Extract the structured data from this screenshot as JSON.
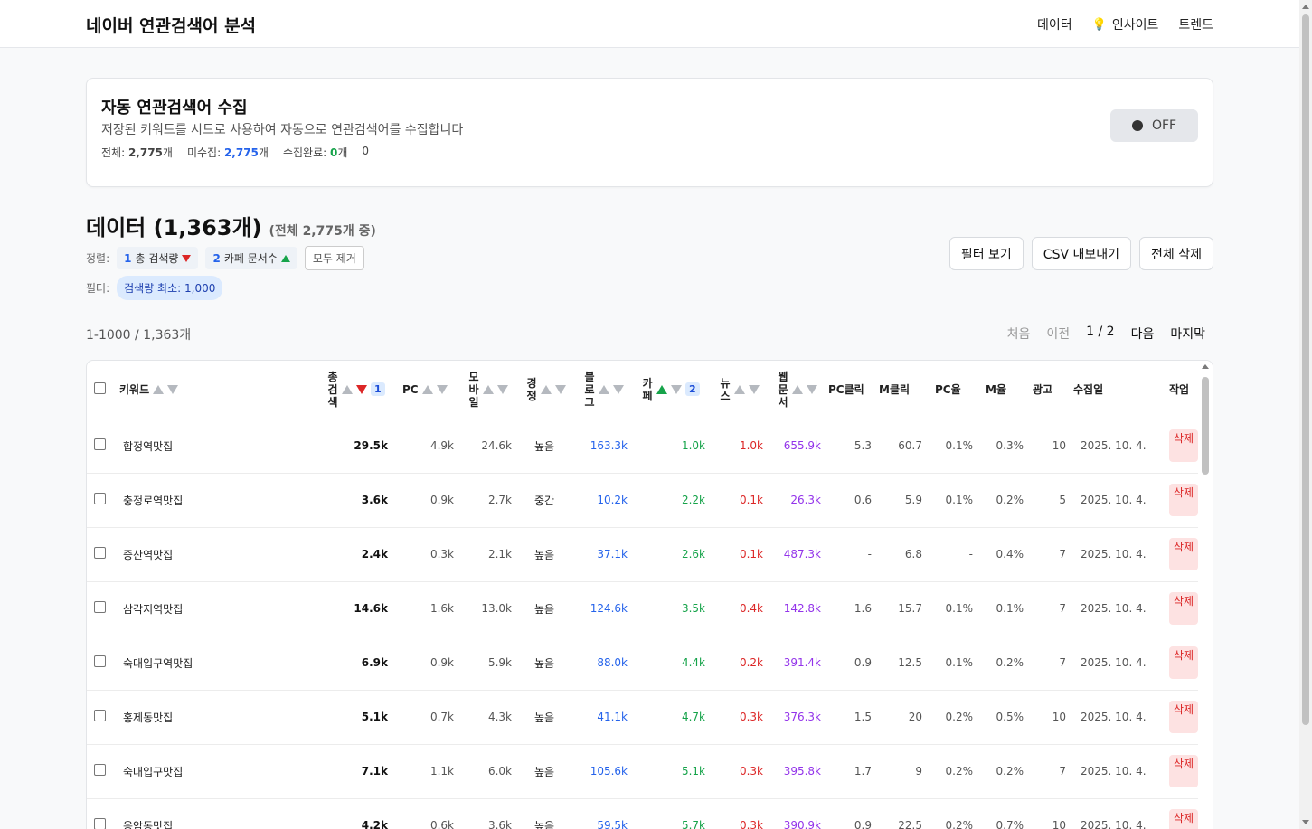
{
  "header": {
    "title": "네이버 연관검색어 분석",
    "nav": [
      {
        "label": "데이터",
        "icon": ""
      },
      {
        "label": "인사이트",
        "icon": "💡"
      },
      {
        "label": "트렌드",
        "icon": ""
      }
    ]
  },
  "auto": {
    "title": "자동 연관검색어 수집",
    "desc": "저장된 키워드를 시드로 사용하여 자동으로 연관검색어를 수집합니다",
    "stats": [
      {
        "label": "전체: ",
        "value": "2,775",
        "unit": "개"
      },
      {
        "label": "미수집: ",
        "value": "2,775",
        "unit": "개"
      },
      {
        "label": "수집완료: ",
        "value": "0",
        "unit": "개"
      },
      {
        "label": "",
        "value": "0",
        "unit": ""
      }
    ],
    "toggle": "OFF"
  },
  "data": {
    "title": "데이터 (1,363개)",
    "subtitle": "(전체 2,775개 중)",
    "sort_label": "정렬:",
    "sort_chips": [
      {
        "num": "1",
        "label": "총 검색량",
        "dir": "desc"
      },
      {
        "num": "2",
        "label": "카페 문서수",
        "dir": "asc"
      }
    ],
    "clear_all": "모두 제거",
    "filter_label": "필터:",
    "filter_chip": "검색량 최소: 1,000",
    "buttons": [
      "필터 보기",
      "CSV 내보내기",
      "전체 삭제"
    ],
    "range": "1-1000 / 1,363개",
    "pager": {
      "first": "처음",
      "prev": "이전",
      "current": "1 / 2",
      "next": "다음",
      "last": "마지막"
    }
  },
  "table": {
    "headers": {
      "keyword": "키워드",
      "total": "총검색",
      "total_rank": "1",
      "pc": "PC",
      "mobile": "모바일",
      "comp": "경쟁",
      "blog": "블로그",
      "cafe": "카페",
      "cafe_rank": "2",
      "news": "뉴스",
      "web": "웹문서",
      "pc_click": "PC클릭",
      "m_click": "M클릭",
      "pc_rate": "PC율",
      "m_rate": "M율",
      "ads": "광고",
      "date": "수집일",
      "action": "작업"
    },
    "delete_label": "삭제",
    "rows": [
      {
        "keyword": "합정역맛집",
        "total": "29.5k",
        "pc": "4.9k",
        "mobile": "24.6k",
        "comp": "높음",
        "blog": "163.3k",
        "cafe": "1.0k",
        "news": "1.0k",
        "web": "655.9k",
        "pc_click": "5.3",
        "m_click": "60.7",
        "pc_rate": "0.1%",
        "m_rate": "0.3%",
        "ads": "10",
        "date": "2025. 10. 4."
      },
      {
        "keyword": "충정로역맛집",
        "total": "3.6k",
        "pc": "0.9k",
        "mobile": "2.7k",
        "comp": "중간",
        "blog": "10.2k",
        "cafe": "2.2k",
        "news": "0.1k",
        "web": "26.3k",
        "pc_click": "0.6",
        "m_click": "5.9",
        "pc_rate": "0.1%",
        "m_rate": "0.2%",
        "ads": "5",
        "date": "2025. 10. 4."
      },
      {
        "keyword": "증산역맛집",
        "total": "2.4k",
        "pc": "0.3k",
        "mobile": "2.1k",
        "comp": "높음",
        "blog": "37.1k",
        "cafe": "2.6k",
        "news": "0.1k",
        "web": "487.3k",
        "pc_click": "-",
        "m_click": "6.8",
        "pc_rate": "-",
        "m_rate": "0.4%",
        "ads": "7",
        "date": "2025. 10. 4."
      },
      {
        "keyword": "삼각지역맛집",
        "total": "14.6k",
        "pc": "1.6k",
        "mobile": "13.0k",
        "comp": "높음",
        "blog": "124.6k",
        "cafe": "3.5k",
        "news": "0.4k",
        "web": "142.8k",
        "pc_click": "1.6",
        "m_click": "15.7",
        "pc_rate": "0.1%",
        "m_rate": "0.1%",
        "ads": "7",
        "date": "2025. 10. 4."
      },
      {
        "keyword": "숙대입구역맛집",
        "total": "6.9k",
        "pc": "0.9k",
        "mobile": "5.9k",
        "comp": "높음",
        "blog": "88.0k",
        "cafe": "4.4k",
        "news": "0.2k",
        "web": "391.4k",
        "pc_click": "0.9",
        "m_click": "12.5",
        "pc_rate": "0.1%",
        "m_rate": "0.2%",
        "ads": "7",
        "date": "2025. 10. 4."
      },
      {
        "keyword": "홍제동맛집",
        "total": "5.1k",
        "pc": "0.7k",
        "mobile": "4.3k",
        "comp": "높음",
        "blog": "41.1k",
        "cafe": "4.7k",
        "news": "0.3k",
        "web": "376.3k",
        "pc_click": "1.5",
        "m_click": "20",
        "pc_rate": "0.2%",
        "m_rate": "0.5%",
        "ads": "10",
        "date": "2025. 10. 4."
      },
      {
        "keyword": "숙대입구맛집",
        "total": "7.1k",
        "pc": "1.1k",
        "mobile": "6.0k",
        "comp": "높음",
        "blog": "105.6k",
        "cafe": "5.1k",
        "news": "0.3k",
        "web": "395.8k",
        "pc_click": "1.7",
        "m_click": "9",
        "pc_rate": "0.2%",
        "m_rate": "0.2%",
        "ads": "7",
        "date": "2025. 10. 4."
      },
      {
        "keyword": "응암동맛집",
        "total": "4.2k",
        "pc": "0.6k",
        "mobile": "3.6k",
        "comp": "높음",
        "blog": "59.5k",
        "cafe": "5.7k",
        "news": "0.3k",
        "web": "390.9k",
        "pc_click": "0.9",
        "m_click": "22.5",
        "pc_rate": "0.2%",
        "m_rate": "0.7%",
        "ads": "10",
        "date": "2025. 10. 4."
      }
    ]
  }
}
